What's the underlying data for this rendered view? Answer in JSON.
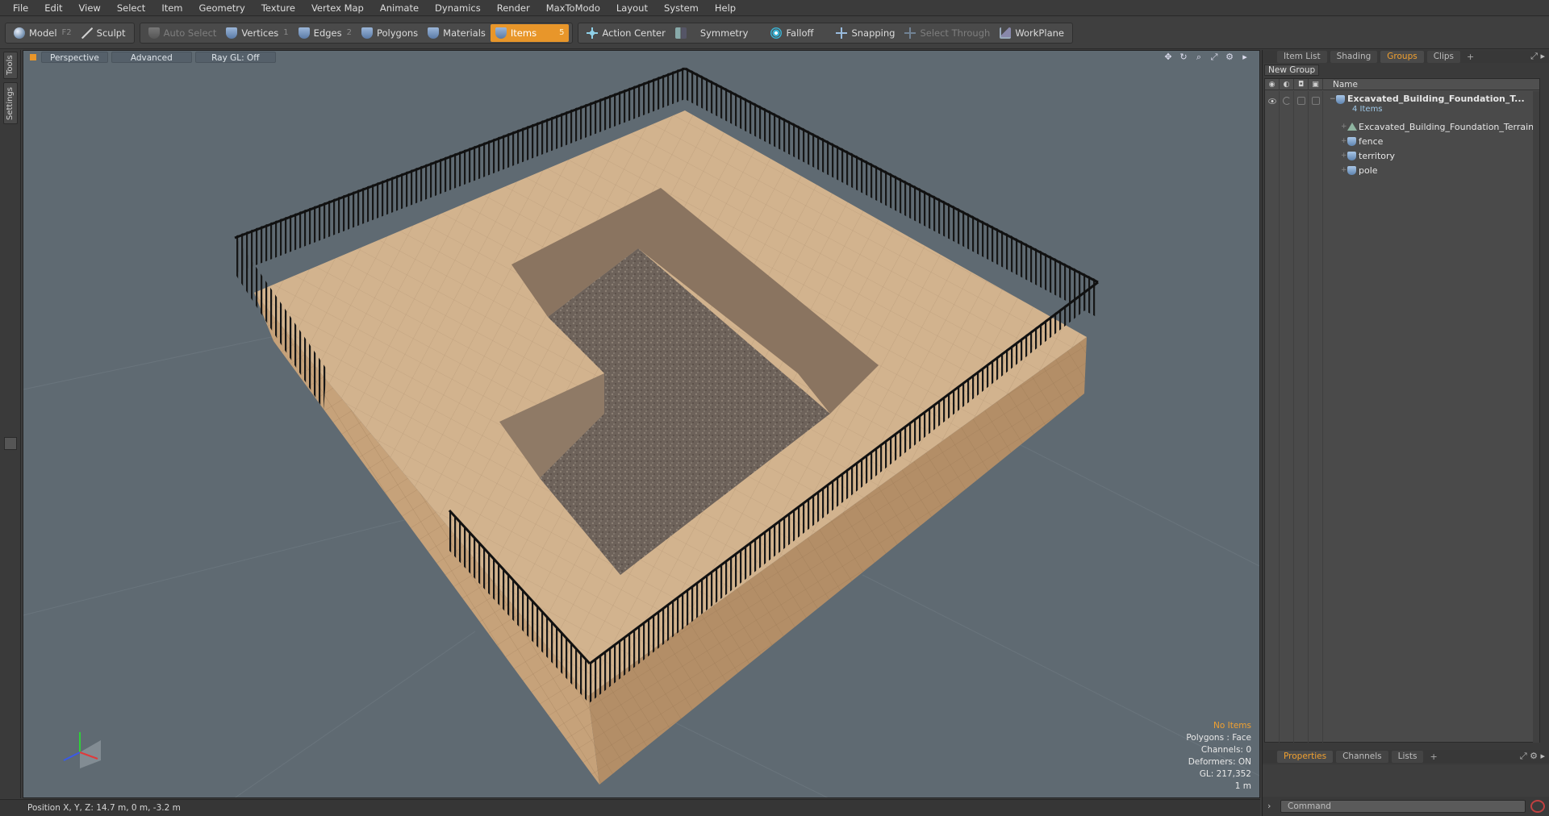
{
  "menu": [
    "File",
    "Edit",
    "View",
    "Select",
    "Item",
    "Geometry",
    "Texture",
    "Vertex Map",
    "Animate",
    "Dynamics",
    "Render",
    "MaxToModo",
    "Layout",
    "System",
    "Help"
  ],
  "toolbar": {
    "model": "Model",
    "model_key": "F2",
    "sculpt": "Sculpt",
    "auto_select": "Auto Select",
    "vertices": "Vertices",
    "vertices_key": "1",
    "edges": "Edges",
    "edges_key": "2",
    "polygons": "Polygons",
    "materials": "Materials",
    "items": "Items",
    "items_key": "5",
    "action_center": "Action Center",
    "symmetry": "Symmetry",
    "falloff": "Falloff",
    "snapping": "Snapping",
    "select_through": "Select Through",
    "workplane": "WorkPlane"
  },
  "left_tabs": {
    "tools": "Tools",
    "settings": "Settings"
  },
  "viewport": {
    "view": "Perspective",
    "shading": "Advanced",
    "raygl": "Ray GL: Off",
    "info": {
      "selection": "No Items",
      "polygons": "Polygons : Face",
      "channels": "Channels: 0",
      "deformers": "Deformers: ON",
      "gl": "GL: 217,352",
      "scale": "1 m"
    }
  },
  "status": {
    "position": "Position X, Y, Z:   14.7 m, 0 m, -3.2 m"
  },
  "right_panel": {
    "tabs": [
      "Item List",
      "Shading",
      "Groups",
      "Clips"
    ],
    "active_tab": "Groups",
    "new_group": "New Group",
    "name_col": "Name",
    "group": {
      "name": "Excavated_Building_Foundation_T...",
      "count": "4 Items"
    },
    "items": [
      "Excavated_Building_Foundation_Terrain",
      "fence",
      "territory",
      "pole"
    ],
    "bottom_tabs": [
      "Properties",
      "Channels",
      "Lists"
    ],
    "bottom_active": "Properties",
    "command_placeholder": "Command"
  },
  "colors": {
    "accent": "#e8962a",
    "viewport_bg": "#5f6a72"
  }
}
